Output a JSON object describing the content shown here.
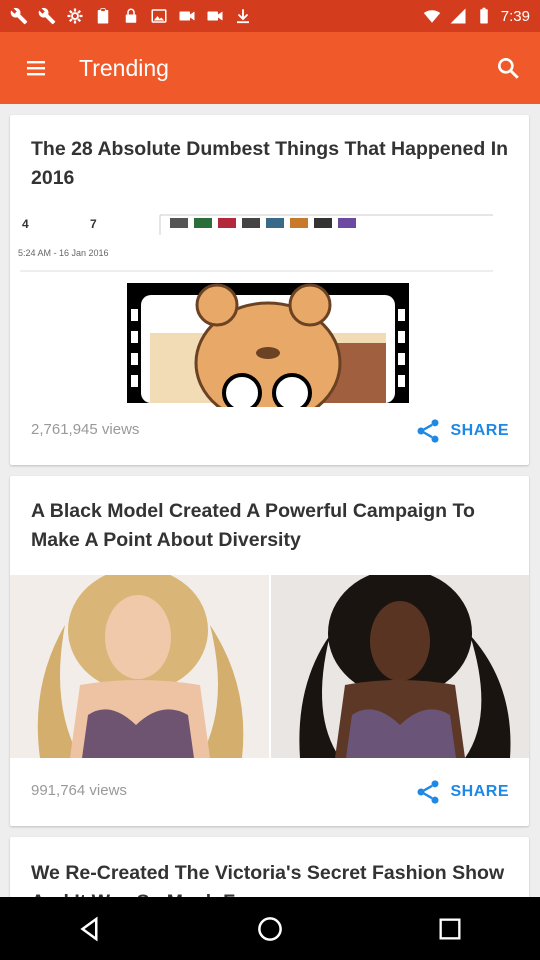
{
  "status_bar": {
    "time": "7:39"
  },
  "app_bar": {
    "title": "Trending"
  },
  "cards": [
    {
      "title": "The 28 Absolute Dumbest Things That Happened In 2016",
      "views": "2,761,945 views",
      "share_label": "SHARE",
      "image_text": {
        "count_a": "4",
        "count_b": "7",
        "timestamp": "5:24 AM - 16 Jan 2016"
      }
    },
    {
      "title": "A Black Model Created A Powerful Campaign To Make A Point About Diversity",
      "views": "991,764 views",
      "share_label": "SHARE"
    },
    {
      "title": "We Re-Created The Victoria's Secret Fashion Show And It Was So Much Fun"
    }
  ],
  "colors": {
    "app_bar": "#f05a2a",
    "status_bar": "#d43c1e",
    "share": "#1e88e5"
  }
}
